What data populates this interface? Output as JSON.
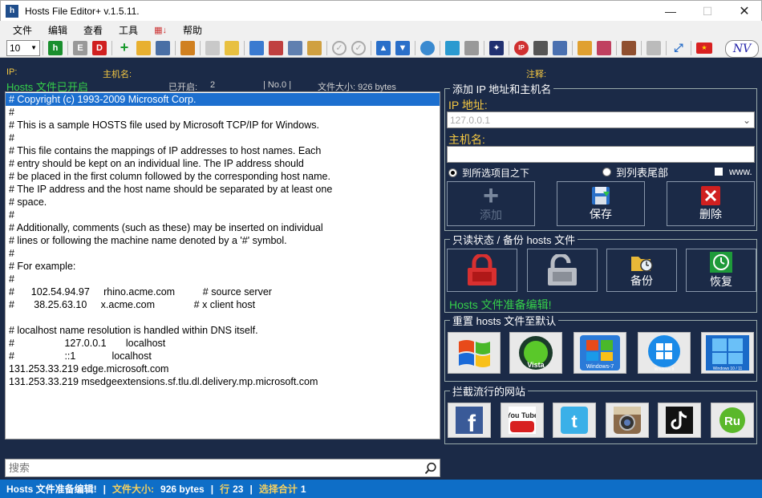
{
  "window": {
    "title": "Hosts File Editor+ v.1.5.11.",
    "app_icon": "h"
  },
  "menu": [
    "文件",
    "编辑",
    "查看",
    "工具",
    "帮助"
  ],
  "toolbar": {
    "font_size": "10"
  },
  "logo": "NV",
  "header": {
    "ip_label": "IP:",
    "hostname_label": "主机名:",
    "comment_label": "注释:"
  },
  "info": {
    "status": "Hosts 文件已开启",
    "enabled_label": "已开启:",
    "enabled_count": "2",
    "no_label": "| No.0 |",
    "size_label": "文件大小: 926 bytes"
  },
  "editor": {
    "lines": [
      "# Copyright (c) 1993-2009 Microsoft Corp.",
      "#",
      "# This is a sample HOSTS file used by Microsoft TCP/IP for Windows.",
      "#",
      "# This file contains the mappings of IP addresses to host names. Each",
      "# entry should be kept on an individual line. The IP address should",
      "# be placed in the first column followed by the corresponding host name.",
      "# The IP address and the host name should be separated by at least one",
      "# space.",
      "#",
      "# Additionally, comments (such as these) may be inserted on individual",
      "# lines or following the machine name denoted by a '#' symbol.",
      "#",
      "# For example:",
      "#",
      "#      102.54.94.97     rhino.acme.com          # source server",
      "#       38.25.63.10     x.acme.com              # x client host",
      "",
      "# localhost name resolution is handled within DNS itself.",
      "#                  127.0.0.1       localhost",
      "#                  ::1             localhost",
      "131.253.33.219 edge.microsoft.com",
      "131.253.33.219 msedgeextensions.sf.tlu.dl.delivery.mp.microsoft.com"
    ]
  },
  "search": {
    "placeholder": "搜索"
  },
  "status": {
    "ready": "Hosts 文件准备编辑!",
    "size_label": "文件大小:",
    "size_value": "926 bytes",
    "line_label": "行",
    "line_value": "23",
    "sel_label": "选择合计",
    "sel_value": "1"
  },
  "add_panel": {
    "title": "添加 IP 地址和主机名",
    "ip_label": "IP 地址:",
    "ip_placeholder": "127.0.0.1",
    "host_label": "主机名:",
    "host_value": "",
    "radio_above": "到所选项目之下",
    "radio_end": "到列表尾部",
    "www_label": "www.",
    "add_btn": "添加",
    "save_btn": "保存",
    "delete_btn": "删除"
  },
  "readonly_panel": {
    "title": "只读状态 / 备份 hosts 文件",
    "backup_btn": "备份",
    "restore_btn": "恢复",
    "ready": "Hosts 文件准备编辑!"
  },
  "reset_panel": {
    "title": "重置 hosts 文件至默认",
    "tiles": [
      "",
      "Vista",
      "Windows-7",
      "Windows 8",
      "Windows 10 / 11"
    ]
  },
  "block_panel": {
    "title": "拦截流行的网站",
    "sites": [
      "f",
      "You Tube",
      "t",
      "",
      "",
      "Ru"
    ]
  },
  "colors": {
    "accent": "#0e6ec7",
    "label": "#f5c842",
    "ready": "#35d04a",
    "bg": "#1b2a47"
  }
}
